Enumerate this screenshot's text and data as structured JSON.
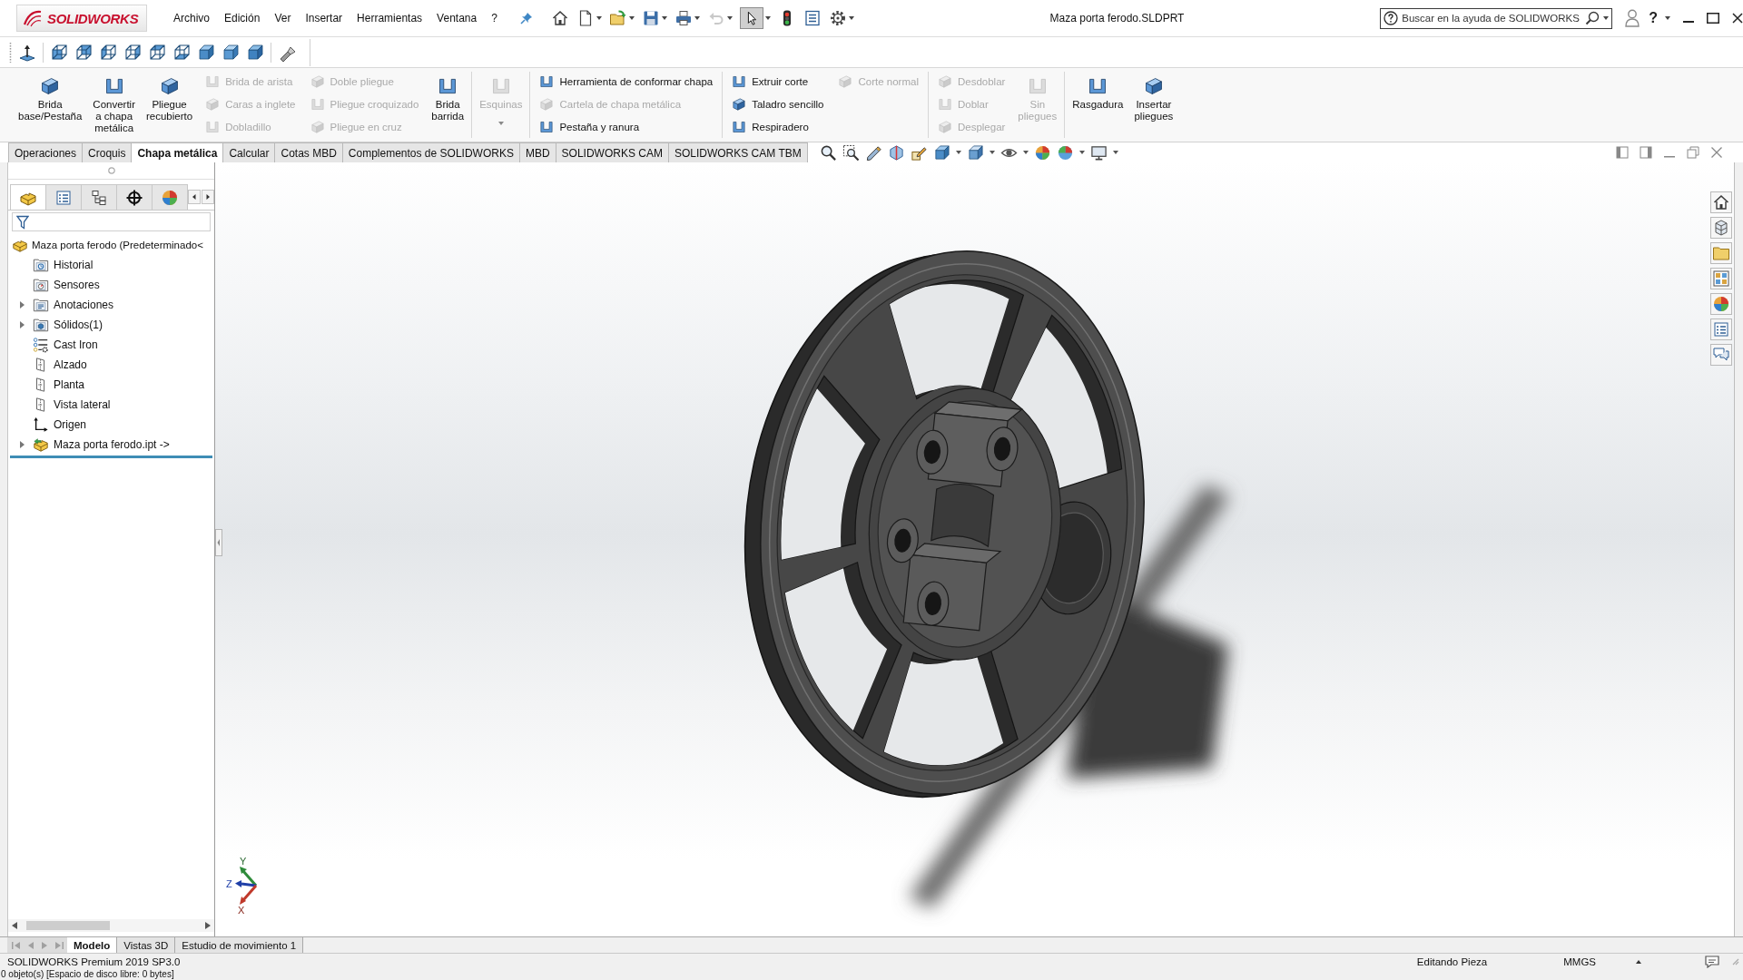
{
  "title_bar": {
    "logo_text": "SOLIDWORKS",
    "menus": [
      "Archivo",
      "Edición",
      "Ver",
      "Insertar",
      "Herramientas",
      "Ventana",
      "?"
    ],
    "document_title": "Maza porta ferodo.SLDPRT",
    "help_search": {
      "placeholder": "Buscar en la ayuda de SOLIDWORKS"
    },
    "help_button": "?"
  },
  "quick_access": [
    {
      "kind": "home",
      "dropdown": false,
      "disabled": false,
      "pressed": false
    },
    {
      "kind": "new",
      "dropdown": true,
      "disabled": false,
      "pressed": false
    },
    {
      "kind": "open",
      "dropdown": true,
      "disabled": false,
      "pressed": false
    },
    {
      "kind": "save",
      "dropdown": true,
      "disabled": false,
      "pressed": false
    },
    {
      "kind": "print",
      "dropdown": true,
      "disabled": false,
      "pressed": false
    },
    {
      "kind": "undo",
      "dropdown": true,
      "disabled": true,
      "pressed": false
    },
    {
      "kind": "select",
      "dropdown": true,
      "disabled": false,
      "pressed": true
    },
    {
      "kind": "rebuild",
      "dropdown": false,
      "disabled": false,
      "pressed": false
    },
    {
      "kind": "file_properties",
      "dropdown": false,
      "disabled": false,
      "pressed": false
    },
    {
      "kind": "options",
      "dropdown": true,
      "disabled": false,
      "pressed": false
    }
  ],
  "ribbon": [
    {
      "kind": "large",
      "label": "Brida\nbase/Pestaña",
      "disabled": false,
      "dropdown": false
    },
    {
      "kind": "large",
      "label": "Convertir\na chapa\nmetálica",
      "disabled": false,
      "dropdown": false
    },
    {
      "kind": "large",
      "label": "Pliegue\nrecubierto",
      "disabled": false,
      "dropdown": false
    },
    {
      "kind": "stack",
      "items": [
        {
          "label": "Brida de arista",
          "disabled": true
        },
        {
          "label": "Caras a inglete",
          "disabled": true
        },
        {
          "label": "Dobladillo",
          "disabled": true
        }
      ]
    },
    {
      "kind": "stack",
      "items": [
        {
          "label": "Doble pliegue",
          "disabled": true
        },
        {
          "label": "Pliegue croquizado",
          "disabled": true
        },
        {
          "label": "Pliegue en cruz",
          "disabled": true
        }
      ]
    },
    {
      "kind": "large",
      "label": "Brida\nbarrida",
      "disabled": false,
      "dropdown": false
    },
    {
      "kind": "separator"
    },
    {
      "kind": "large",
      "label": "Esquinas",
      "disabled": true,
      "dropdown": true
    },
    {
      "kind": "separator"
    },
    {
      "kind": "stack",
      "items": [
        {
          "label": "Herramienta de conformar chapa",
          "disabled": false
        },
        {
          "label": "Cartela de chapa metálica",
          "disabled": true
        },
        {
          "label": "Pestaña y ranura",
          "disabled": false
        }
      ]
    },
    {
      "kind": "separator"
    },
    {
      "kind": "stack",
      "items": [
        {
          "label": "Extruir corte",
          "disabled": false
        },
        {
          "label": "Taladro sencillo",
          "disabled": false
        },
        {
          "label": "Respiradero",
          "disabled": false
        }
      ]
    },
    {
      "kind": "stack",
      "items": [
        {
          "label": "Corte normal",
          "disabled": true
        }
      ]
    },
    {
      "kind": "separator"
    },
    {
      "kind": "stack",
      "items": [
        {
          "label": "Desdoblar",
          "disabled": true
        },
        {
          "label": "Doblar",
          "disabled": true
        },
        {
          "label": "Desplegar",
          "disabled": true
        }
      ]
    },
    {
      "kind": "large",
      "label": "Sin\npliegues",
      "disabled": true,
      "dropdown": false
    },
    {
      "kind": "separator"
    },
    {
      "kind": "large",
      "label": "Rasgadura",
      "disabled": false,
      "dropdown": false
    },
    {
      "kind": "large",
      "label": "Insertar\npliegues",
      "disabled": false,
      "dropdown": false
    }
  ],
  "tabs": [
    {
      "label": "Operaciones",
      "selected": false
    },
    {
      "label": "Croquis",
      "selected": false
    },
    {
      "label": "Chapa metálica",
      "selected": true
    },
    {
      "label": "Calcular",
      "selected": false
    },
    {
      "label": "Cotas MBD",
      "selected": false
    },
    {
      "label": "Complementos de SOLIDWORKS",
      "selected": false
    },
    {
      "label": "MBD",
      "selected": false
    },
    {
      "label": "SOLIDWORKS CAM",
      "selected": false
    },
    {
      "label": "SOLIDWORKS CAM TBM",
      "selected": false
    }
  ],
  "feature_manager": {
    "panel_tabs": [
      {
        "kind": "feature_tree",
        "selected": true
      },
      {
        "kind": "property",
        "selected": false
      },
      {
        "kind": "configuration",
        "selected": false
      },
      {
        "kind": "dimxpert",
        "selected": false
      },
      {
        "kind": "display",
        "selected": false
      }
    ],
    "tree": {
      "label": "Maza porta ferodo (Predeterminado<",
      "kind": "part",
      "children": [
        {
          "label": "Historial",
          "kind": "history_folder",
          "expandable": false
        },
        {
          "label": "Sensores",
          "kind": "sensor_folder",
          "expandable": false
        },
        {
          "label": "Anotaciones",
          "kind": "annotation_folder",
          "expandable": true,
          "expanded": false
        },
        {
          "label": "Sólidos(1)",
          "kind": "solid_folder",
          "expandable": true,
          "expanded": false
        },
        {
          "label": "Cast Iron",
          "kind": "material",
          "expandable": false
        },
        {
          "label": "Alzado",
          "kind": "plane",
          "expandable": false
        },
        {
          "label": "Planta",
          "kind": "plane",
          "expandable": false
        },
        {
          "label": "Vista lateral",
          "kind": "plane",
          "expandable": false
        },
        {
          "label": "Origen",
          "kind": "origin",
          "expandable": false
        },
        {
          "label": "Maza porta ferodo.ipt ->",
          "kind": "derived_part",
          "expandable": true,
          "expanded": false
        }
      ]
    }
  },
  "graphics": {
    "triad": {
      "y_label": "Y",
      "z_label": "Z",
      "x_label": "X"
    }
  },
  "bottom_tabs": [
    {
      "label": "Modelo",
      "selected": true
    },
    {
      "label": "Vistas 3D",
      "selected": false
    },
    {
      "label": "Estudio de movimiento 1",
      "selected": false
    }
  ],
  "status_bar": {
    "product": "SOLIDWORKS Premium 2019 SP3.0",
    "mode": "Editando Pieza",
    "units": "MMGS",
    "message": "0 objeto(s) [Espacio de disco libre: 0 bytes]"
  }
}
